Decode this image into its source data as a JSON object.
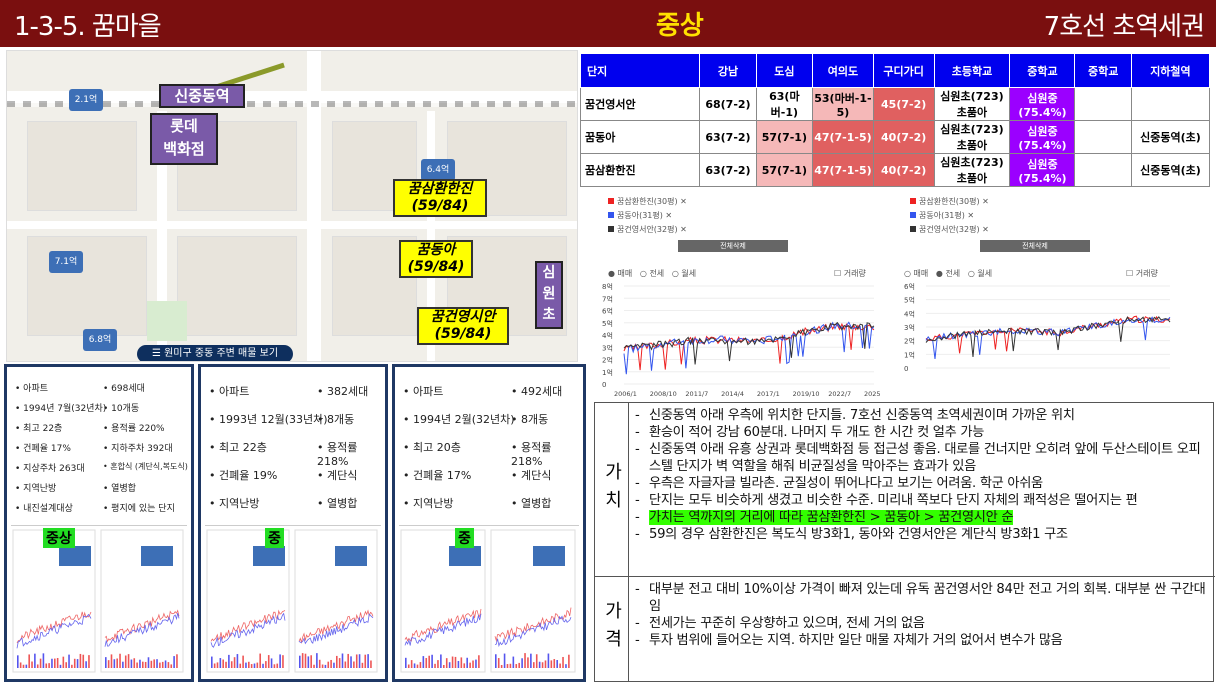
{
  "header": {
    "left": "1-3-5. 꿈마을",
    "mid": "중상",
    "right": "7호선 초역세권"
  },
  "map": {
    "station": "신중동역",
    "dept": "롯데\n백화점",
    "school": "심\n원\n초",
    "apt1": "꿈삼환한진\n(59/84)",
    "apt2": "꿈동아\n(59/84)",
    "apt3": "꿈건영시안\n(59/84)",
    "price_pins": [
      "2.1억",
      "6.4억",
      "7.1억",
      "6.8억"
    ],
    "bottom_button": "☰ 원미구 중동 주변 매물 보기"
  },
  "table": {
    "headers": [
      "단지",
      "강남",
      "도심",
      "여의도",
      "구디가디",
      "초등학교",
      "중학교",
      "중학교",
      "지하철역"
    ],
    "rows": [
      [
        "꿈건영서안",
        "68(7-2)",
        "63(마버-1)",
        "53(마버-1-5)",
        "45(7-2)",
        "심원초(723) 초품아",
        "심원중 (75.4%)",
        "",
        ""
      ],
      [
        "꿈동아",
        "63(7-2)",
        "57(7-1)",
        "47(7-1-5)",
        "40(7-2)",
        "심원초(723) 초품아",
        "심원중 (75.4%)",
        "",
        "신중동역(초)"
      ],
      [
        "꿈삼환한진",
        "63(7-2)",
        "57(7-1)",
        "47(7-1-5)",
        "40(7-2)",
        "심원초(723) 초품아",
        "심원중 (75.4%)",
        "",
        "신중동역(초)"
      ]
    ]
  },
  "charts": {
    "legend": [
      "꿈삼환한진(30평)",
      "꿈동아(31평)",
      "꿈건영서안(32평)"
    ],
    "delete_all": "전체삭제",
    "tabs": [
      "매매",
      "전세",
      "월세"
    ],
    "volume": "거래량",
    "left_y": [
      "8억",
      "7억",
      "6억",
      "5억",
      "4억",
      "3억",
      "2억",
      "1억",
      "0"
    ],
    "left_x": [
      "2006/1",
      "2008/10",
      "2011/7",
      "2014/4",
      "2017/1",
      "2019/10",
      "2022/7",
      "2025/4"
    ],
    "right_y": [
      "6억",
      "5억",
      "4억",
      "3억",
      "2억",
      "1억",
      "0"
    ],
    "colors": {
      "red": "#ee2222",
      "blue": "#3355ee",
      "dark": "#333333"
    }
  },
  "boxes": [
    {
      "items": [
        "• 아파트",
        "• 698세대",
        "• 1994년 7월(32년차)",
        "• 10개동",
        "• 최고 22층",
        "• 용적률 220%",
        "• 건폐율 17%",
        "• 지하주차 392대",
        "• 지상주차 263대",
        "• 혼합식 (계단식,복도식)",
        "• 지역난방",
        "• 열병합",
        "• 내진설계대상",
        "• 평지에 있는 단지"
      ],
      "tag": "중상"
    },
    {
      "items": [
        "• 아파트",
        "• 382세대",
        "• 1993년 12월(33년차)",
        "• 8개동",
        "• 최고 22층",
        "• 용적률 218%",
        "• 건폐율 19%",
        "• 계단식",
        "• 지역난방",
        "• 열병합"
      ],
      "tag": "중"
    },
    {
      "items": [
        "• 아파트",
        "• 492세대",
        "• 1994년 2월(32년차)",
        "• 8개동",
        "• 최고 20층",
        "• 용적률 218%",
        "• 건폐율 17%",
        "• 계단식",
        "• 지역난방",
        "• 열병합"
      ],
      "tag": "중"
    }
  ],
  "notes": {
    "value_title": "가치",
    "value_items": [
      "신중동역 아래 우측에 위치한 단지들. 7호선 신중동역 초역세권이며 가까운 위치",
      "환승이 적어 강남 60분대. 나머지 두 개도 한 시간 컷 얼추 가능",
      "신중동역 아래 유흥 상권과 롯데백화점 등 접근성 좋음. 대로를 건너지만 오히려 앞에 두산스테이트 오피스텔 단지가 벽 역할을 해줘 비균질성을 막아주는 효과가 있음",
      "우측은 자글자글 빌라촌. 균질성이 뛰어나다고 보기는 어려움. 학군 아쉬움",
      "단지는 모두 비슷하게 생겼고 비슷한 수준. 미리내 쪽보다 단지 자체의 쾌적성은 떨어지는 편",
      "가치는 역까지의 거리에 따라 꿈삼환한진 > 꿈동아 > 꿈건영시안 순",
      "59의 경우 삼환한진은 복도식 방3화1, 동아와 건영서안은 계단식 방3화1 구조"
    ],
    "price_title": "가격",
    "price_items": [
      "대부분 전고 대비 10%이상 가격이 빠져 있는데 유독 꿈건영서안 84만 전고 거의 회복. 대부분 싼 구간대임",
      "전세가는 꾸준히 우상향하고 있으며, 전세 거의 없음",
      "투자 범위에 들어오는 지역. 하지만 일단 매물 자체가 거의 없어서 변수가 많음"
    ]
  }
}
